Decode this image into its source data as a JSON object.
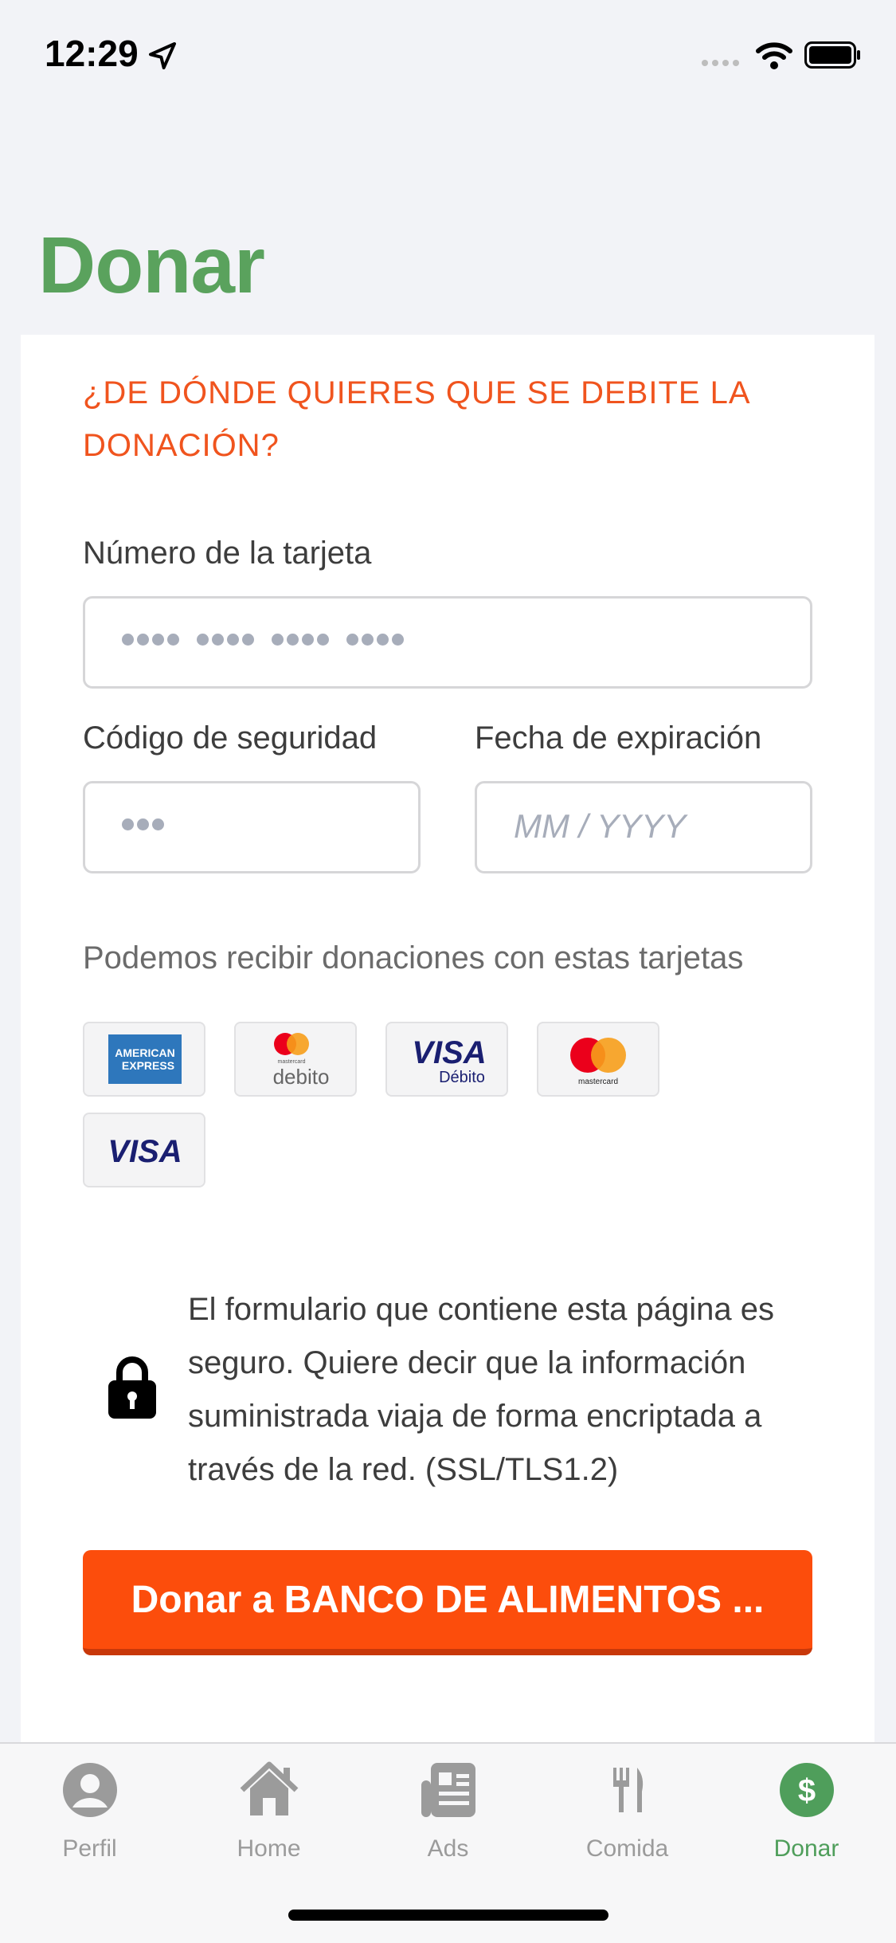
{
  "status_bar": {
    "time": "12:29"
  },
  "page": {
    "title": "Donar"
  },
  "form": {
    "question": "¿DE DÓNDE QUIERES QUE SE DEBITE LA DONACIÓN?",
    "card_number": {
      "label": "Número de la tarjeta",
      "value": "•••• •••• •••• ••••"
    },
    "security_code": {
      "label": "Código de seguridad",
      "value": "•••"
    },
    "expiration": {
      "label": "Fecha de expiración",
      "placeholder": "MM / YYYY"
    },
    "accepted_text": "Podemos recibir donaciones con estas tarjetas",
    "accepted_cards": [
      "AMERICAN EXPRESS",
      "mastercard debito",
      "VISA Débito",
      "mastercard",
      "VISA"
    ],
    "secure_notice": "El formulario que contiene esta página es seguro. Quiere decir que la información suministrada viaja de forma encriptada a través de la red. (SSL/TLS1.2)",
    "donate_button": "Donar a BANCO DE ALIMENTOS ..."
  },
  "card_logos": {
    "amex_line1": "AMERICAN",
    "amex_line2": "EXPRESS",
    "mc_small": "mastercard",
    "debito": "debito",
    "visa": "VISA",
    "visa_debito": "Débito"
  },
  "tabbar": {
    "items": [
      {
        "label": "Perfil",
        "icon": "person-icon",
        "active": false
      },
      {
        "label": "Home",
        "icon": "home-icon",
        "active": false
      },
      {
        "label": "Ads",
        "icon": "newspaper-icon",
        "active": false
      },
      {
        "label": "Comida",
        "icon": "fork-knife-icon",
        "active": false
      },
      {
        "label": "Donar",
        "icon": "dollar-icon",
        "active": true
      }
    ]
  },
  "colors": {
    "title_green": "#5aa25d",
    "accent_orange": "#fc4d0c",
    "active_tab": "#4f9e5b"
  }
}
